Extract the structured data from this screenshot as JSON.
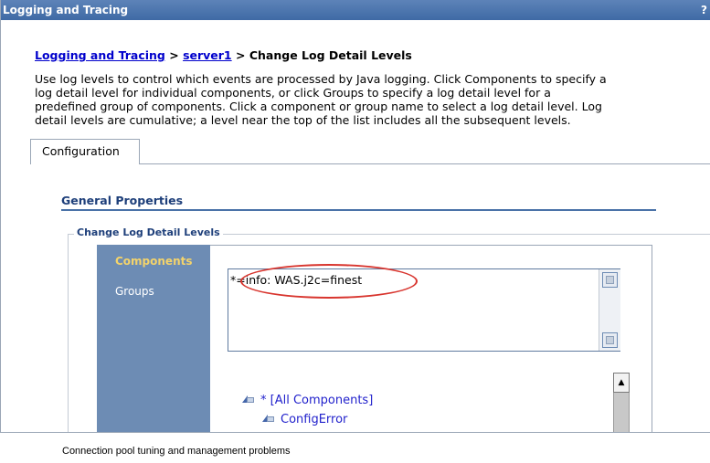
{
  "window": {
    "title": "Logging and Tracing",
    "help": "?"
  },
  "breadcrumb": {
    "root": "Logging and Tracing",
    "sep1": ">",
    "server": "server1",
    "sep2": ">",
    "current": "Change Log Detail Levels"
  },
  "description": [
    "Use log levels to control which events are processed by Java logging. Click Components to specify a",
    "log detail level for individual components, or click Groups to specify a log detail level for a",
    "predefined group of components. Click a component or group name to select a log detail level. Log",
    "detail levels are cumulative; a level near the top of the list includes all the subsequent levels."
  ],
  "tabs": [
    {
      "label": "Configuration"
    }
  ],
  "general_properties": {
    "title": "General Properties"
  },
  "fieldset": {
    "legend": "Change Log Detail Levels"
  },
  "sidebar": {
    "components": "Components",
    "groups": "Groups"
  },
  "spec": {
    "value": "*=info: WAS.j2c=finest"
  },
  "tree": [
    {
      "label": "* [All Components]"
    },
    {
      "label": "ConfigError"
    }
  ],
  "caption": "Connection pool tuning and management problems",
  "colors": {
    "titlebar": "#4670aa",
    "sidebar": "#6d8cb4",
    "highlight": "#d8352e",
    "link": "#0000cc"
  }
}
